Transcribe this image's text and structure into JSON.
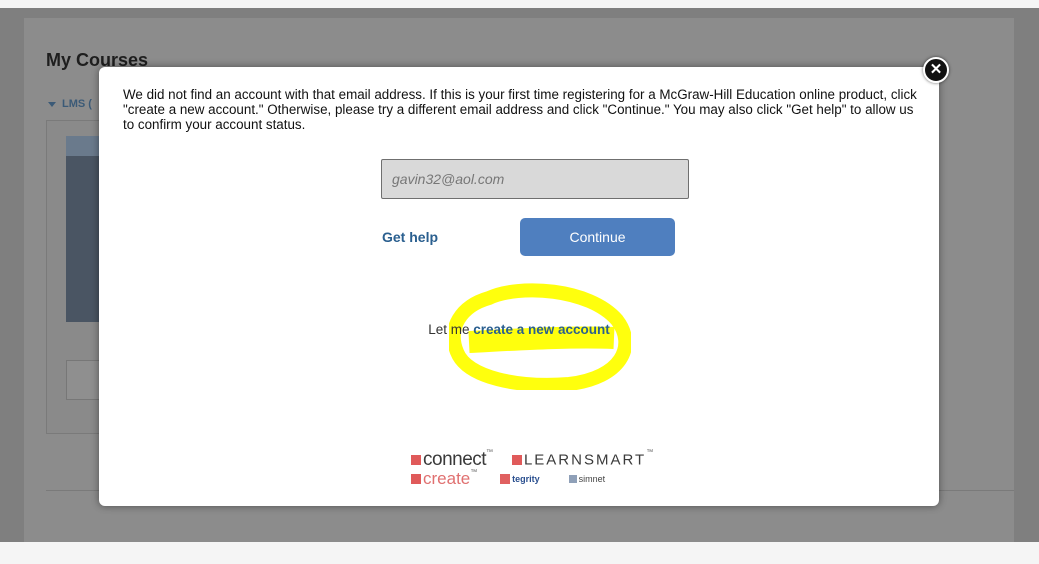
{
  "background": {
    "title": "My Courses",
    "section_label": "LMS (",
    "overlay_color": "#7f7f7f"
  },
  "modal": {
    "close_symbol": "✕",
    "message": "We did not find an account with that email address. If this is your first time registering for a McGraw-Hill Education online product, click \"create a new account.\" Otherwise, please try a different email address and click \"Continue.\" You may also click \"Get help\" to allow us to confirm your account status.",
    "email_value": "gavin32@aol.com",
    "get_help_label": "Get help",
    "continue_label": "Continue",
    "create_prefix": "Let me",
    "create_link_label": "create a new account",
    "highlight_color": "#ffff00",
    "logos": {
      "connect": "connect",
      "learnsmart": "LEARNSMART",
      "create": "create",
      "tegrity": "tegrity",
      "simnet": "simnet"
    }
  },
  "colors": {
    "link": "#2a5f8f",
    "button": "#4f7fbf",
    "brand_red": "#e05a5a"
  }
}
